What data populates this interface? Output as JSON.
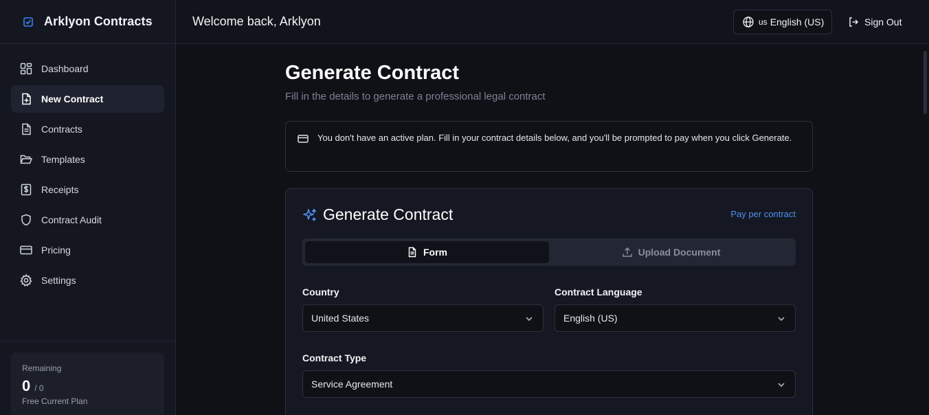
{
  "brand": {
    "name": "Arklyon Contracts",
    "logo_icon": "check-square-icon",
    "accent": "#3b82f6"
  },
  "sidebar": {
    "items": [
      {
        "label": "Dashboard",
        "icon": "dashboard-grid-icon",
        "active": false
      },
      {
        "label": "New Contract",
        "icon": "file-plus-icon",
        "active": true
      },
      {
        "label": "Contracts",
        "icon": "file-text-icon",
        "active": false
      },
      {
        "label": "Templates",
        "icon": "folder-open-icon",
        "active": false
      },
      {
        "label": "Receipts",
        "icon": "dollar-file-icon",
        "active": false
      },
      {
        "label": "Contract Audit",
        "icon": "shield-icon",
        "active": false
      },
      {
        "label": "Pricing",
        "icon": "credit-card-icon",
        "active": false
      },
      {
        "label": "Settings",
        "icon": "gear-icon",
        "active": false
      }
    ],
    "plan": {
      "label": "Remaining",
      "remaining": "0",
      "total": "/ 0",
      "name": "Free Current Plan"
    }
  },
  "header": {
    "welcome": "Welcome back, Arklyon",
    "language": {
      "code": "us",
      "label": "English (US)",
      "icon": "globe-icon"
    },
    "sign_out": {
      "label": "Sign Out",
      "icon": "log-out-icon"
    }
  },
  "main": {
    "title": "Generate Contract",
    "subtitle": "Fill in the details to generate a professional legal contract",
    "notice": {
      "icon": "credit-card-icon",
      "text": "You don't have an active plan. Fill in your contract details below, and you'll be prompted to pay when you click Generate."
    },
    "card": {
      "title": "Generate Contract",
      "icon": "sparkles-icon",
      "pay_link": "Pay per contract",
      "tabs": [
        {
          "label": "Form",
          "icon": "file-text-icon",
          "active": true
        },
        {
          "label": "Upload Document",
          "icon": "upload-icon",
          "active": false
        }
      ],
      "fields": {
        "country": {
          "label": "Country",
          "value": "United States"
        },
        "language": {
          "label": "Contract Language",
          "value": "English (US)"
        },
        "type": {
          "label": "Contract Type",
          "value": "Service Agreement"
        }
      }
    }
  }
}
